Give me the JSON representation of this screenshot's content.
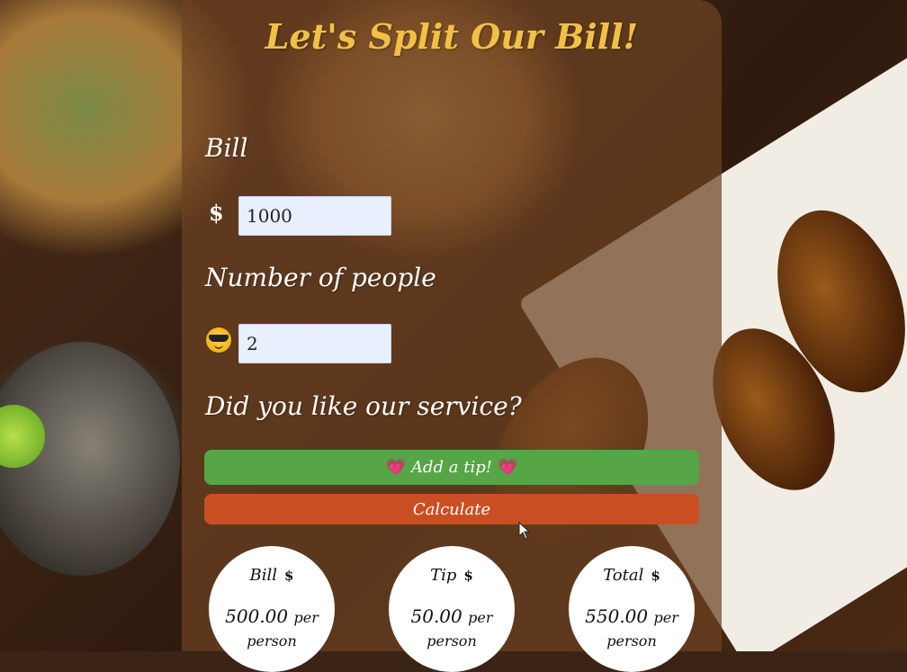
{
  "app": {
    "title": "Let's Split Our Bill!"
  },
  "bill": {
    "label": "Bill",
    "currency": "$",
    "value": "1000"
  },
  "people": {
    "label": "Number of people",
    "icon": "sunglasses-face-icon",
    "value": "2"
  },
  "service": {
    "label": "Did you like our service?"
  },
  "buttons": {
    "tip_label": "Add a tip!",
    "tip_icon": "heart-icon",
    "calculate_label": "Calculate"
  },
  "results": [
    {
      "label": "Bill",
      "currency": "$",
      "value": "500.00",
      "unit": "per person"
    },
    {
      "label": "Tip",
      "currency": "$",
      "value": "50.00",
      "unit": "per person"
    },
    {
      "label": "Total",
      "currency": "$",
      "value": "550.00",
      "unit": "per person"
    }
  ],
  "colors": {
    "title": "#f1c046",
    "tip_button": "#56a546",
    "calculate_button": "#c94f22",
    "panel": "#6e4222"
  }
}
